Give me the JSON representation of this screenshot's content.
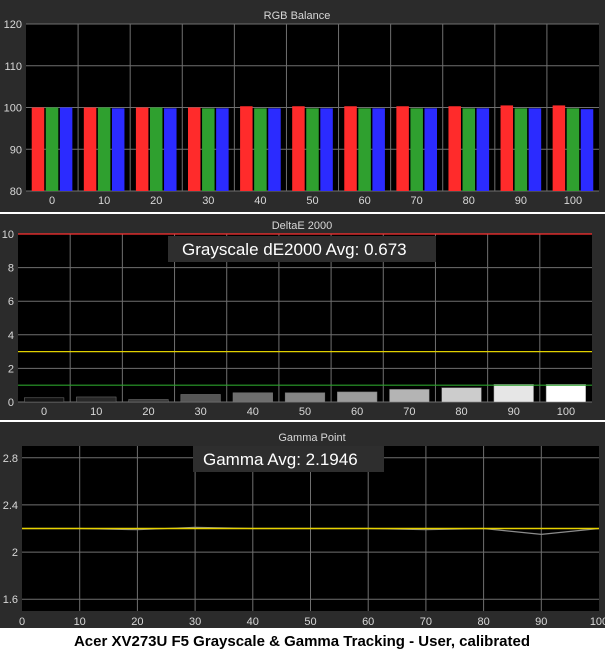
{
  "caption": "Acer XV273U F5 Grayscale & Gamma Tracking - User, calibrated",
  "colors": {
    "red": "#ff2b2b",
    "green": "#2fa02f",
    "blue": "#2b2bff",
    "threshold_yellow": "#e0d000",
    "threshold_green": "#2aa02a",
    "max_red": "#ff3030",
    "gamma_line_yellow": "#e6d200",
    "gamma_line_gray": "#8c8c8c"
  },
  "chart_data": [
    {
      "type": "bar",
      "title": "RGB Balance",
      "categories": [
        "0",
        "10",
        "20",
        "30",
        "40",
        "50",
        "60",
        "70",
        "80",
        "90",
        "100"
      ],
      "series": [
        {
          "color": "#ff2b2b",
          "values": [
            100,
            100,
            100,
            100,
            100.3,
            100.3,
            100.3,
            100.3,
            100.3,
            100.5,
            100.5
          ]
        },
        {
          "color": "#2fa02f",
          "values": [
            100,
            100,
            100,
            99.8,
            99.8,
            99.8,
            99.8,
            99.8,
            99.8,
            99.8,
            99.8
          ]
        },
        {
          "color": "#2b2bff",
          "values": [
            100,
            99.8,
            99.8,
            99.8,
            99.8,
            99.8,
            99.8,
            99.8,
            99.8,
            99.8,
            99.6
          ]
        }
      ],
      "ylim": [
        80,
        120
      ],
      "yticks": [
        80,
        90,
        100,
        110,
        120
      ],
      "grid": true
    },
    {
      "type": "bar",
      "title": "DeltaE 2000",
      "annotation": "Grayscale dE2000 Avg: 0.673",
      "categories": [
        "0",
        "10",
        "20",
        "30",
        "40",
        "50",
        "60",
        "70",
        "80",
        "90",
        "100"
      ],
      "values": [
        0.25,
        0.3,
        0.15,
        0.45,
        0.55,
        0.55,
        0.6,
        0.75,
        0.85,
        1.05,
        1.05
      ],
      "value_colors": [
        "#141414",
        "#282828",
        "#3c3c3c",
        "#565656",
        "#6e6e6e",
        "#858585",
        "#9c9c9c",
        "#b4b4b4",
        "#cccccc",
        "#e6e6e6",
        "#ffffff"
      ],
      "thresholds": [
        {
          "value": 10,
          "color": "#ff3030"
        },
        {
          "value": 3,
          "color": "#e0d000"
        },
        {
          "value": 1,
          "color": "#2aa02a"
        }
      ],
      "ylim": [
        0,
        10
      ],
      "yticks": [
        0,
        2,
        4,
        6,
        8,
        10
      ],
      "grid": true
    },
    {
      "type": "line",
      "title": "Gamma Point",
      "annotation": "Gamma Avg: 2.1946",
      "x": [
        0,
        10,
        20,
        30,
        40,
        50,
        60,
        70,
        80,
        90,
        100
      ],
      "series": [
        {
          "color": "#e6d200",
          "values": [
            2.2,
            2.2,
            2.2,
            2.2,
            2.2,
            2.2,
            2.2,
            2.2,
            2.2,
            2.2,
            2.2
          ]
        },
        {
          "color": "#8c8c8c",
          "values": [
            2.2,
            2.2,
            2.19,
            2.21,
            2.2,
            2.2,
            2.2,
            2.19,
            2.2,
            2.15,
            2.2
          ]
        }
      ],
      "xlim": [
        0,
        100
      ],
      "xticks": [
        0,
        10,
        20,
        30,
        40,
        50,
        60,
        70,
        80,
        90,
        100
      ],
      "ylim": [
        1.5,
        2.9
      ],
      "yticks": [
        1.6,
        2,
        2.4,
        2.8
      ],
      "grid": true
    }
  ]
}
